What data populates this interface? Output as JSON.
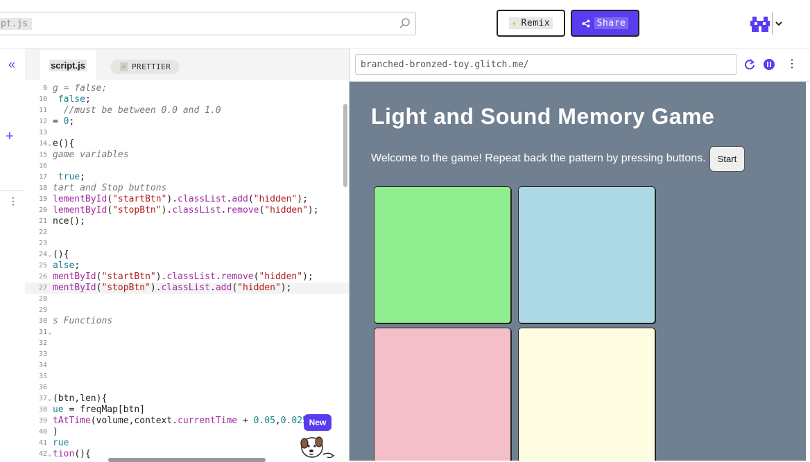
{
  "topbar": {
    "search_text": "pt.js",
    "remix_label": "Remix",
    "share_label": "Share"
  },
  "editor": {
    "file_tab": "script.js",
    "prettier_label": "PRETTIER",
    "code_lines": [
      {
        "n": "9",
        "html": "<span class=\"c-cmt\">g = false;</span>"
      },
      {
        "n": "10",
        "html": "<span class=\"c-kw\"> false</span><span class=\"c-plain\">;</span>"
      },
      {
        "n": "11",
        "html": "<span class=\"c-cmt\">  //must be between 0.0 and 1.0</span>"
      },
      {
        "n": "12",
        "html": "<span class=\"c-plain\">= </span><span class=\"c-num\">0</span><span class=\"c-plain\">;</span>"
      },
      {
        "n": "13",
        "html": ""
      },
      {
        "n": "14",
        "fold": true,
        "html": "<span class=\"c-plain\">e(){</span>"
      },
      {
        "n": "15",
        "html": "<span class=\"c-cmt\">game variables</span>"
      },
      {
        "n": "16",
        "html": ""
      },
      {
        "n": "17",
        "html": "<span class=\"c-kw\"> true</span><span class=\"c-plain\">;</span>"
      },
      {
        "n": "18",
        "html": "<span class=\"c-cmt\">tart and Stop buttons</span>"
      },
      {
        "n": "19",
        "html": "<span class=\"c-prop\">lementById</span><span class=\"c-plain\">(</span><span class=\"c-str\">\"startBtn\"</span><span class=\"c-plain\">).</span><span class=\"c-prop\">classList</span><span class=\"c-plain\">.</span><span class=\"c-prop\">add</span><span class=\"c-plain\">(</span><span class=\"c-str\">\"hidden\"</span><span class=\"c-plain\">);</span>"
      },
      {
        "n": "20",
        "html": "<span class=\"c-prop\">lementById</span><span class=\"c-plain\">(</span><span class=\"c-str\">\"stopBtn\"</span><span class=\"c-plain\">).</span><span class=\"c-prop\">classList</span><span class=\"c-plain\">.</span><span class=\"c-prop\">remove</span><span class=\"c-plain\">(</span><span class=\"c-str\">\"hidden\"</span><span class=\"c-plain\">);</span>"
      },
      {
        "n": "21",
        "html": "<span class=\"c-plain\">nce();</span>"
      },
      {
        "n": "22",
        "html": ""
      },
      {
        "n": "23",
        "html": ""
      },
      {
        "n": "24",
        "fold": true,
        "html": "<span class=\"c-plain\">(){</span>"
      },
      {
        "n": "25",
        "html": "<span class=\"c-kw\">alse</span><span class=\"c-plain\">;</span>"
      },
      {
        "n": "26",
        "html": "<span class=\"c-prop\">mentById</span><span class=\"c-plain\">(</span><span class=\"c-str\">\"startBtn\"</span><span class=\"c-plain\">).</span><span class=\"c-prop\">classList</span><span class=\"c-plain\">.</span><span class=\"c-prop\">remove</span><span class=\"c-plain\">(</span><span class=\"c-str\">\"hidden\"</span><span class=\"c-plain\">);</span>"
      },
      {
        "n": "27",
        "active": true,
        "html": "<span class=\"c-prop\">mentById</span><span class=\"c-plain\">(</span><span class=\"c-str\">\"stopBtn\"</span><span class=\"c-plain\">).</span><span class=\"c-prop\">classList</span><span class=\"c-plain\">.</span><span class=\"c-prop\">add</span><span class=\"c-plain\">(</span><span class=\"c-str\">\"hidden\"</span><span class=\"c-plain\">);</span>"
      },
      {
        "n": "28",
        "html": ""
      },
      {
        "n": "29",
        "html": ""
      },
      {
        "n": "30",
        "html": "<span class=\"c-cmt\">s Functions</span>"
      },
      {
        "n": "31",
        "fold": true,
        "html": ""
      },
      {
        "n": "32",
        "html": ""
      },
      {
        "n": "33",
        "html": ""
      },
      {
        "n": "34",
        "html": ""
      },
      {
        "n": "35",
        "html": ""
      },
      {
        "n": "36",
        "html": ""
      },
      {
        "n": "37",
        "fold": true,
        "html": "<span class=\"c-plain\">(btn,len){</span>"
      },
      {
        "n": "38",
        "html": "<span class=\"c-kw\">ue</span><span class=\"c-plain\"> = freqMap[btn]</span>"
      },
      {
        "n": "39",
        "html": "<span class=\"c-prop\">tAtTime</span><span class=\"c-plain\">(volume,context.</span><span class=\"c-prop\">currentTime</span><span class=\"c-plain\"> + </span><span class=\"c-num\">0.05</span><span class=\"c-plain\">,</span><span class=\"c-num\">0.025</span><span class=\"c-plain\">)</span>"
      },
      {
        "n": "40",
        "html": "<span class=\"c-plain\">)</span>"
      },
      {
        "n": "41",
        "html": "<span class=\"c-kw\">rue</span>"
      },
      {
        "n": "42",
        "fold": true,
        "html": "<span class=\"c-prop\">tion</span><span class=\"c-plain\">(){</span>"
      }
    ],
    "new_badge": "New"
  },
  "preview": {
    "url": "branched-bronzed-toy.glitch.me/",
    "title": "Light and Sound Memory Game",
    "intro": "Welcome to the game! Repeat back the pattern by pressing buttons.",
    "start_label": "Start",
    "background_color": "#708090",
    "buttons": [
      {
        "name": "green",
        "color": "#90ee90"
      },
      {
        "name": "blue",
        "color": "#add8e6"
      },
      {
        "name": "pink",
        "color": "#f4bfc9"
      },
      {
        "name": "yellow",
        "color": "#fefde2"
      }
    ]
  },
  "colors": {
    "accent": "#5a3cf0"
  }
}
